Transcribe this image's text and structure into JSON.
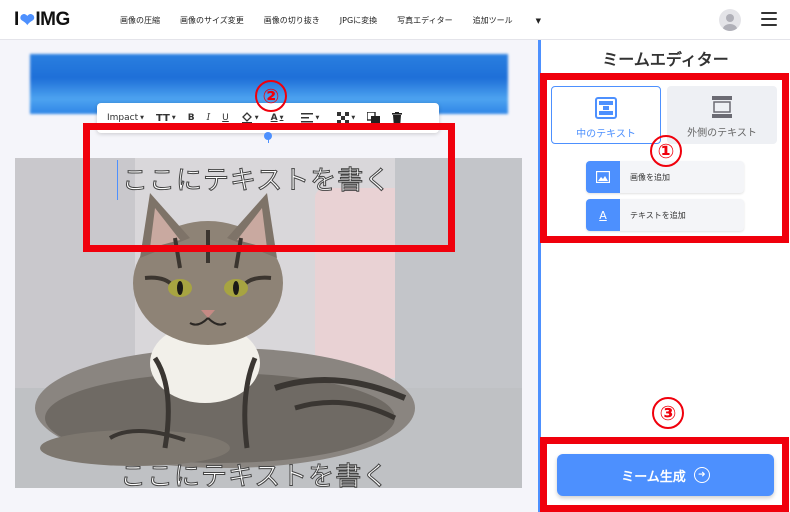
{
  "header": {
    "logo_left": "I",
    "logo_right": "IMG",
    "nav": [
      {
        "label": "画像の圧縮"
      },
      {
        "label": "画像のサイズ変更"
      },
      {
        "label": "画像の切り抜き"
      },
      {
        "label": "JPGに変換"
      },
      {
        "label": "写真エディター"
      },
      {
        "label": "追加ツール"
      }
    ]
  },
  "toolbar": {
    "font": "Impact",
    "size_label": "TT",
    "bold": "B",
    "italic": "I",
    "underline": "U",
    "text_color": "A"
  },
  "canvas": {
    "top_text": "ここにテキストを書く",
    "bottom_text": "ここにテキストを書く"
  },
  "sidebar": {
    "title": "ミームエディター",
    "tabs": [
      {
        "label": "中のテキスト",
        "active": true
      },
      {
        "label": "外側のテキスト",
        "active": false
      }
    ],
    "add_image": "画像を追加",
    "add_text": "テキストを追加",
    "generate": "ミーム生成"
  },
  "annotations": {
    "marker1": "①",
    "marker2": "②",
    "marker3": "③",
    "color": "#f0000c"
  },
  "colors": {
    "accent": "#4d90fe"
  }
}
